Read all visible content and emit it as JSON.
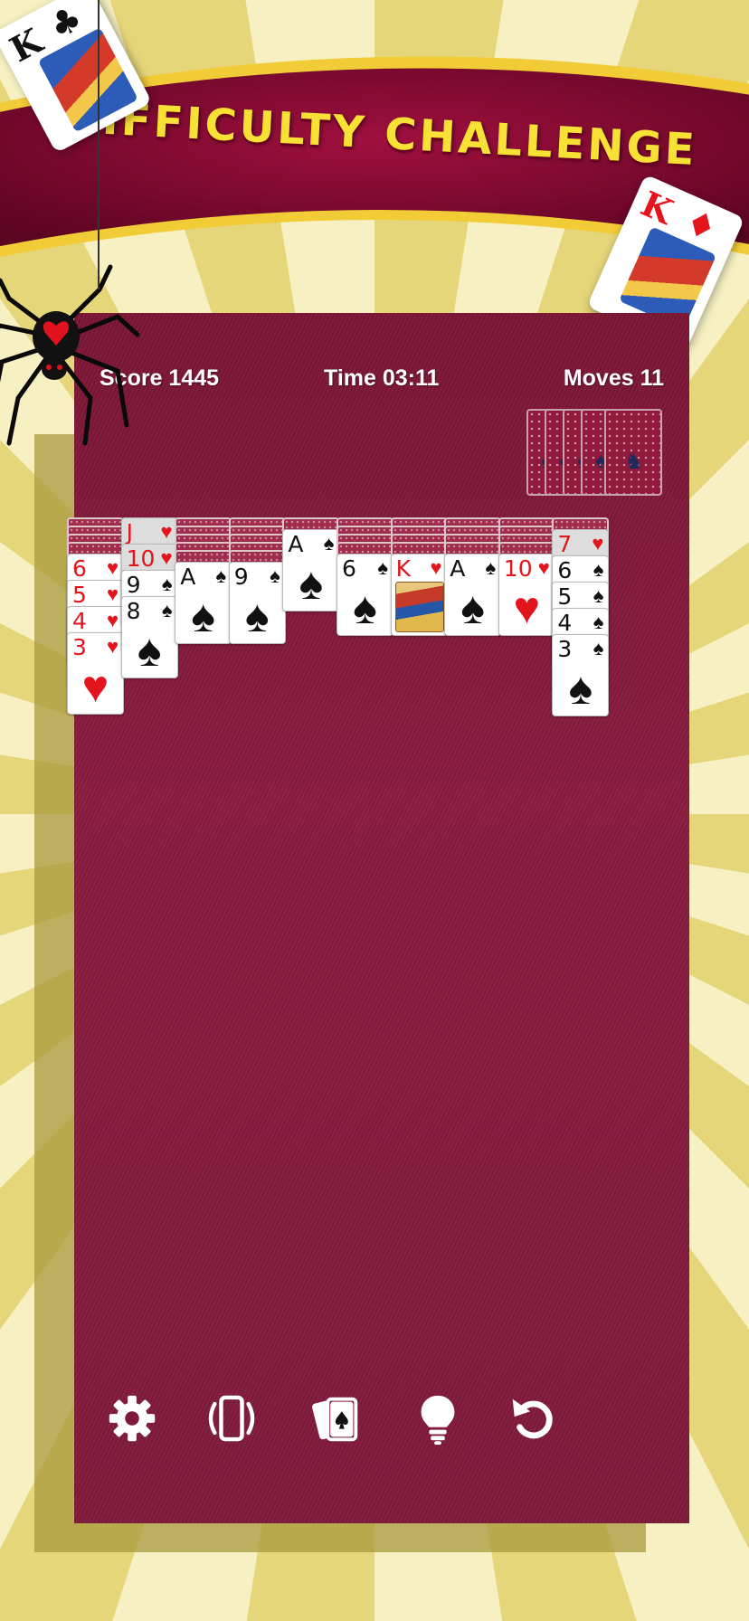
{
  "banner": {
    "title": "DIFFICULTY CHALLENGE"
  },
  "decor": {
    "left_card": {
      "rank": "K",
      "suit": "♣"
    },
    "right_card": {
      "rank": "K",
      "suit": "♦"
    }
  },
  "hud": {
    "score": "Score 1445",
    "time": "Time 03:11",
    "moves": "Moves 11"
  },
  "stock": {
    "piles": 5
  },
  "tableau": [
    {
      "facedown": 4,
      "cards": [
        {
          "rank": "6",
          "suit": "♥",
          "color": "red"
        },
        {
          "rank": "5",
          "suit": "♥",
          "color": "red"
        },
        {
          "rank": "4",
          "suit": "♥",
          "color": "red"
        },
        {
          "rank": "3",
          "suit": "♥",
          "color": "red"
        }
      ]
    },
    {
      "facedown": 0,
      "cards": [
        {
          "rank": "J",
          "suit": "♥",
          "color": "red",
          "dim": true
        },
        {
          "rank": "10",
          "suit": "♥",
          "color": "red",
          "dim": true
        },
        {
          "rank": "9",
          "suit": "♠",
          "color": "black"
        },
        {
          "rank": "8",
          "suit": "♠",
          "color": "black"
        }
      ]
    },
    {
      "facedown": 5,
      "cards": [
        {
          "rank": "A",
          "suit": "♠",
          "color": "black"
        }
      ]
    },
    {
      "facedown": 5,
      "cards": [
        {
          "rank": "9",
          "suit": "♠",
          "color": "black"
        }
      ]
    },
    {
      "facedown": 1,
      "cards": [
        {
          "rank": "A",
          "suit": "♠",
          "color": "black"
        }
      ]
    },
    {
      "facedown": 4,
      "cards": [
        {
          "rank": "6",
          "suit": "♠",
          "color": "black"
        }
      ]
    },
    {
      "facedown": 4,
      "cards": [
        {
          "rank": "K",
          "suit": "♥",
          "color": "red",
          "face": true
        }
      ]
    },
    {
      "facedown": 4,
      "cards": [
        {
          "rank": "A",
          "suit": "♠",
          "color": "black"
        }
      ]
    },
    {
      "facedown": 4,
      "cards": [
        {
          "rank": "10",
          "suit": "♥",
          "color": "red"
        }
      ]
    },
    {
      "facedown": 1,
      "cards": [
        {
          "rank": "7",
          "suit": "♥",
          "color": "red",
          "dim": true
        },
        {
          "rank": "6",
          "suit": "♠",
          "color": "black"
        },
        {
          "rank": "5",
          "suit": "♠",
          "color": "black"
        },
        {
          "rank": "4",
          "suit": "♠",
          "color": "black"
        },
        {
          "rank": "3",
          "suit": "♠",
          "color": "black"
        }
      ]
    }
  ],
  "toolbar": [
    {
      "name": "settings",
      "icon": "gear-icon"
    },
    {
      "name": "orientation",
      "icon": "rotate-phone-icon"
    },
    {
      "name": "deal",
      "icon": "cards-icon"
    },
    {
      "name": "hint",
      "icon": "lightbulb-icon"
    },
    {
      "name": "undo",
      "icon": "undo-icon"
    }
  ],
  "colors": {
    "felt": "#801a3a",
    "banner": "#7a0a2e",
    "banner_text": "#f7e135",
    "red_suit": "#e3141c"
  }
}
